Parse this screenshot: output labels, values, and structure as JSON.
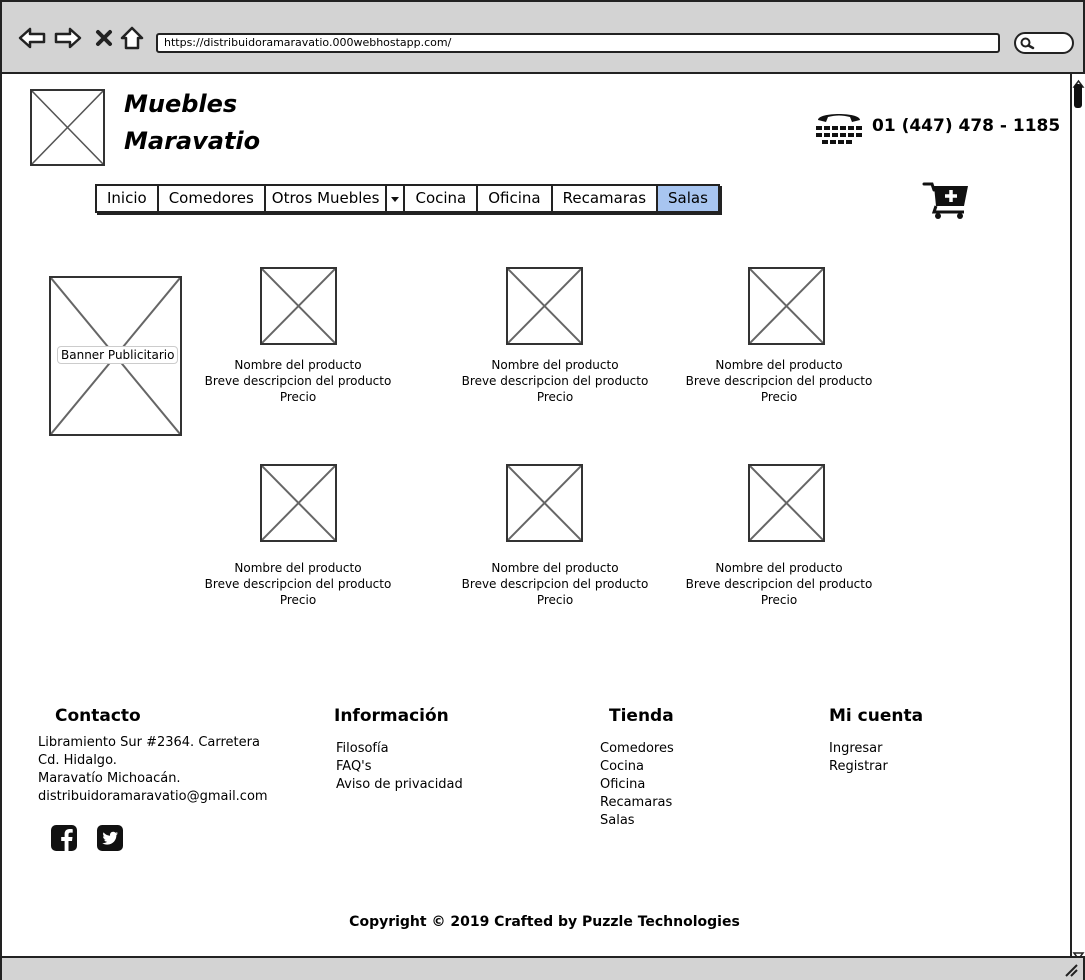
{
  "browser": {
    "url": "https://distribuidoramaravatio.000webhostapp.com/"
  },
  "header": {
    "brand_line1": "Muebles",
    "brand_line2": "Maravatio",
    "phone": "01 (447) 478 - 1185"
  },
  "menu": {
    "items": [
      "Inicio",
      "Comedores",
      "Otros Muebles",
      "Cocina",
      "Oficina",
      "Recamaras",
      "Salas"
    ],
    "active": "Salas",
    "active_color": "#a8c5f0"
  },
  "banner": {
    "label": "Banner Publicitario"
  },
  "products": [
    {
      "name": "Nombre del producto",
      "description": "Breve descripcion del producto",
      "price": "Precio"
    },
    {
      "name": "Nombre del producto",
      "description": "Breve descripcion del producto",
      "price": "Precio"
    },
    {
      "name": "Nombre del producto",
      "description": "Breve descripcion del producto",
      "price": "Precio"
    },
    {
      "name": "Nombre del producto",
      "description": "Breve descripcion del producto",
      "price": "Precio"
    },
    {
      "name": "Nombre del producto",
      "description": "Breve descripcion del producto",
      "price": "Precio"
    },
    {
      "name": "Nombre del producto",
      "description": "Breve descripcion del producto",
      "price": "Precio"
    }
  ],
  "footer": {
    "contact": {
      "title": "Contacto",
      "lines": [
        "Libramiento Sur #2364. Carretera",
        "Cd. Hidalgo.",
        "Maravatío Michoacán.",
        "distribuidoramaravatio@gmail.com"
      ]
    },
    "info": {
      "title": "Información",
      "links": [
        "Filosofía",
        "FAQ's",
        "Aviso de privacidad"
      ]
    },
    "store": {
      "title": "Tienda",
      "links": [
        "Comedores",
        "Cocina",
        "Oficina",
        "Recamaras",
        "Salas"
      ]
    },
    "account": {
      "title": "Mi cuenta",
      "links": [
        "Ingresar",
        "Registrar"
      ]
    },
    "social_icons": [
      "facebook-icon",
      "twitter-icon"
    ],
    "copyright": "Copyright © 2019 Crafted by Puzzle Technologies"
  }
}
